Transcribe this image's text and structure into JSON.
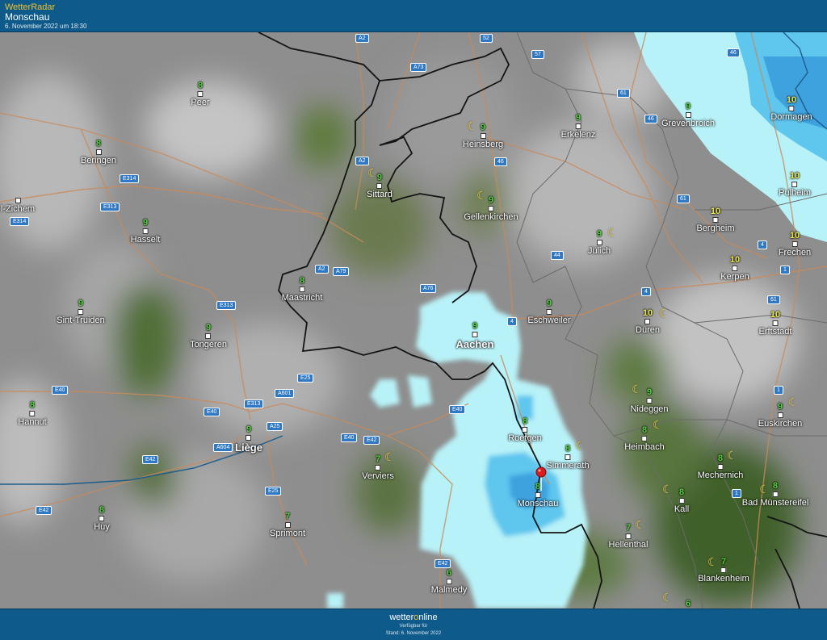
{
  "header": {
    "brand": "WetterRadar",
    "location": "Monschau",
    "timestamp": "6. November 2022 um 18:30"
  },
  "colors": {
    "header_bg": "#0e5a8a",
    "brand_accent": "#f2c230",
    "temp_green": "#52d03a",
    "temp_yellow": "#e8e84a",
    "rain_light": "#b7f2f8",
    "rain_medium": "#5fc6ee",
    "rain_dark": "#3ea2de"
  },
  "cities": [
    {
      "name": "Peer",
      "temp": "8"
    },
    {
      "name": "Beringen",
      "temp": "8"
    },
    {
      "name": "l-Zichem",
      "temp": ""
    },
    {
      "name": "Hasselt",
      "temp": "9"
    },
    {
      "name": "Sint-Truiden",
      "temp": "9"
    },
    {
      "name": "Tongeren",
      "temp": "9"
    },
    {
      "name": "Hannut",
      "temp": "8"
    },
    {
      "name": "Huy",
      "temp": "8"
    },
    {
      "name": "Liège",
      "temp": "9"
    },
    {
      "name": "Maastricht",
      "temp": "8"
    },
    {
      "name": "Sittard",
      "temp": "9"
    },
    {
      "name": "Heinsberg",
      "temp": "9"
    },
    {
      "name": "Gellenkirchen",
      "temp": "9"
    },
    {
      "name": "Erkelenz",
      "temp": "9"
    },
    {
      "name": "Grevenbroich",
      "temp": "9"
    },
    {
      "name": "Dormagen",
      "temp": "10"
    },
    {
      "name": "Pulheim",
      "temp": "10"
    },
    {
      "name": "Bergheim",
      "temp": "10"
    },
    {
      "name": "Jülich",
      "temp": "9"
    },
    {
      "name": "Frechen",
      "temp": "10"
    },
    {
      "name": "Kerpen",
      "temp": "10"
    },
    {
      "name": "Eschweiler",
      "temp": "9"
    },
    {
      "name": "Aachen",
      "temp": "9"
    },
    {
      "name": "Düren",
      "temp": "10"
    },
    {
      "name": "Erftstadt",
      "temp": "10"
    },
    {
      "name": "Nideggen",
      "temp": "9"
    },
    {
      "name": "Euskirchen",
      "temp": "9"
    },
    {
      "name": "Roetgen",
      "temp": "8"
    },
    {
      "name": "Heimbach",
      "temp": "8"
    },
    {
      "name": "Simmerath",
      "temp": "8"
    },
    {
      "name": "Monschau",
      "temp": "8"
    },
    {
      "name": "Verviers",
      "temp": "7"
    },
    {
      "name": "Mechernich",
      "temp": "8"
    },
    {
      "name": "Kall",
      "temp": "8"
    },
    {
      "name": "Bad Münstereifel",
      "temp": "8"
    },
    {
      "name": "Sprimont",
      "temp": "7"
    },
    {
      "name": "Hellenthal",
      "temp": "7"
    },
    {
      "name": "Blankenheim",
      "temp": "7"
    },
    {
      "name": "Malmedy",
      "temp": "6"
    },
    {
      "name": "",
      "temp": "6"
    }
  ],
  "roads": [
    "A2",
    "52",
    "57",
    "46",
    "A73",
    "61",
    "46",
    "46",
    "E314",
    "E313",
    "E314",
    "A2",
    "A2",
    "A79",
    "A76",
    "61",
    "4",
    "44",
    "4",
    "E313",
    "4",
    "1",
    "61",
    "E25",
    "A601",
    "E313",
    "E40",
    "E40",
    "A25",
    "A604",
    "E40",
    "E42",
    "E40",
    "E42",
    "E25",
    "E42",
    "E42",
    "1",
    "1"
  ],
  "moon_icon": "crescent-moon-icon",
  "pin_icon": "location-pin-icon",
  "footer": {
    "logo_a": "wetter",
    "logo_o": "o",
    "logo_b": "nline",
    "available": "Verfügbar für",
    "platforms": "  ",
    "stand": "Stand: 6. November 2022"
  }
}
